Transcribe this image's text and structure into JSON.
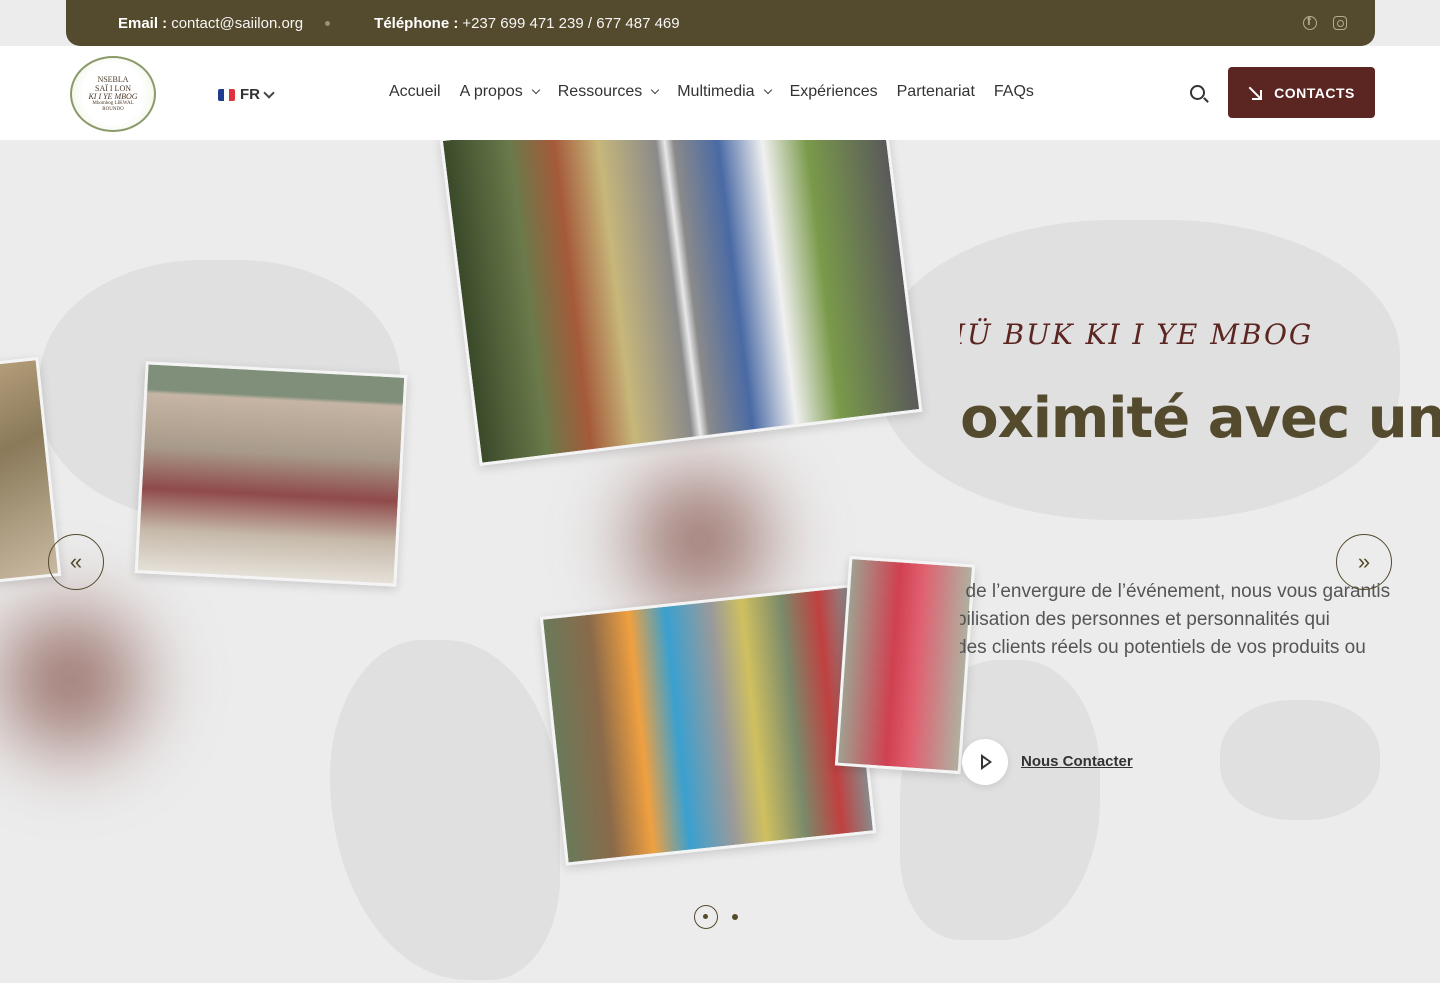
{
  "topbar": {
    "email_label": "Email :",
    "email_value": "contact@saiilon.org",
    "phone_label": "Téléphone :",
    "phone_value": "+237 699 471 239 / 677 487 469",
    "socials": [
      "facebook-icon",
      "instagram-icon"
    ]
  },
  "logo": {
    "line1": "NSEBLA",
    "line2": "SAÏ I LON",
    "line3": "KI I YE MBOG",
    "line4": "Mbombog LIKWAL",
    "line5": "ROUNDO"
  },
  "language": {
    "flag": "fr",
    "code": "FR"
  },
  "nav": {
    "items": [
      {
        "label": "Accueil",
        "dropdown": false
      },
      {
        "label": "A propos",
        "dropdown": true
      },
      {
        "label": "Ressources",
        "dropdown": true
      },
      {
        "label": "Multimedia",
        "dropdown": true
      },
      {
        "label": "Expériences",
        "dropdown": false
      },
      {
        "label": "Partenariat",
        "dropdown": false
      },
      {
        "label": "FAQs",
        "dropdown": false
      }
    ]
  },
  "contacts_button": "CONTACTS",
  "hero": {
    "subtitle": "IÜ BUK KI I YE MBOG",
    "headline": "'oximité avec un",
    "description": [
      "l de l’envergure de l’événement, nous vous garantis",
      "bilisation des personnes et personnalités qui",
      "des clients réels ou potentiels de vos produits ou"
    ],
    "cta": "Nous Contacter",
    "prev_icon": "«",
    "next_icon": "»",
    "slides_count": 2,
    "active_slide": 1
  },
  "colors": {
    "brand_olive": "#544a2d",
    "brand_maroon": "#5b2622",
    "background": "#ececec"
  }
}
